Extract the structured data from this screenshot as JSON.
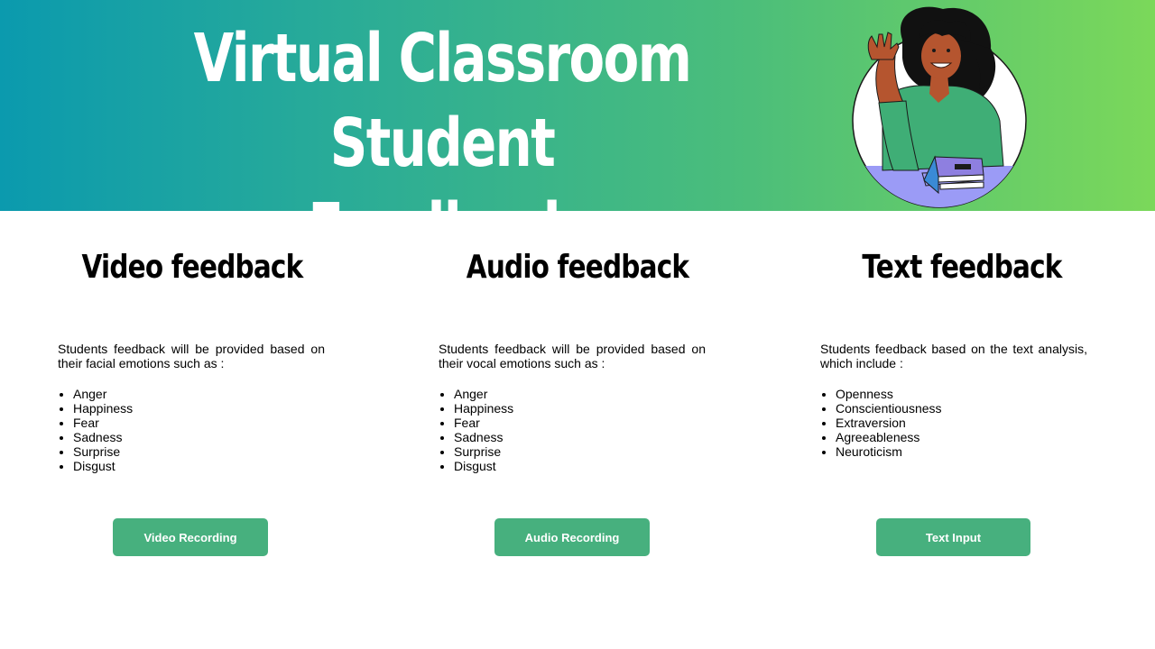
{
  "header": {
    "title_line1": "Virtual Classroom Student",
    "title_line2": "Feedback"
  },
  "colors": {
    "banner_gradient_start": "#0b9aae",
    "banner_gradient_end": "#7bd85a",
    "button": "#47b07e",
    "button_text": "#ffffff"
  },
  "sections": [
    {
      "heading": "Video feedback",
      "description": "Students feedback will be provided based on their facial emotions such as :",
      "items": [
        "Anger",
        "Happiness",
        "Fear",
        "Sadness",
        "Surprise",
        "Disgust"
      ],
      "button_label": "Video Recording"
    },
    {
      "heading": "Audio feedback",
      "description": "Students feedback will be provided based on their vocal emotions such as :",
      "items": [
        "Anger",
        "Happiness",
        "Fear",
        "Sadness",
        "Surprise",
        "Disgust"
      ],
      "button_label": "Audio Recording"
    },
    {
      "heading": "Text feedback",
      "description": "Students feedback based on the text analysis, which include :",
      "items": [
        "Openness",
        "Conscientiousness",
        "Extraversion",
        "Agreeableness",
        "Neuroticism"
      ],
      "button_label": "Text Input"
    }
  ],
  "icons": {
    "avatar": "waving-student-with-books-illustration"
  }
}
